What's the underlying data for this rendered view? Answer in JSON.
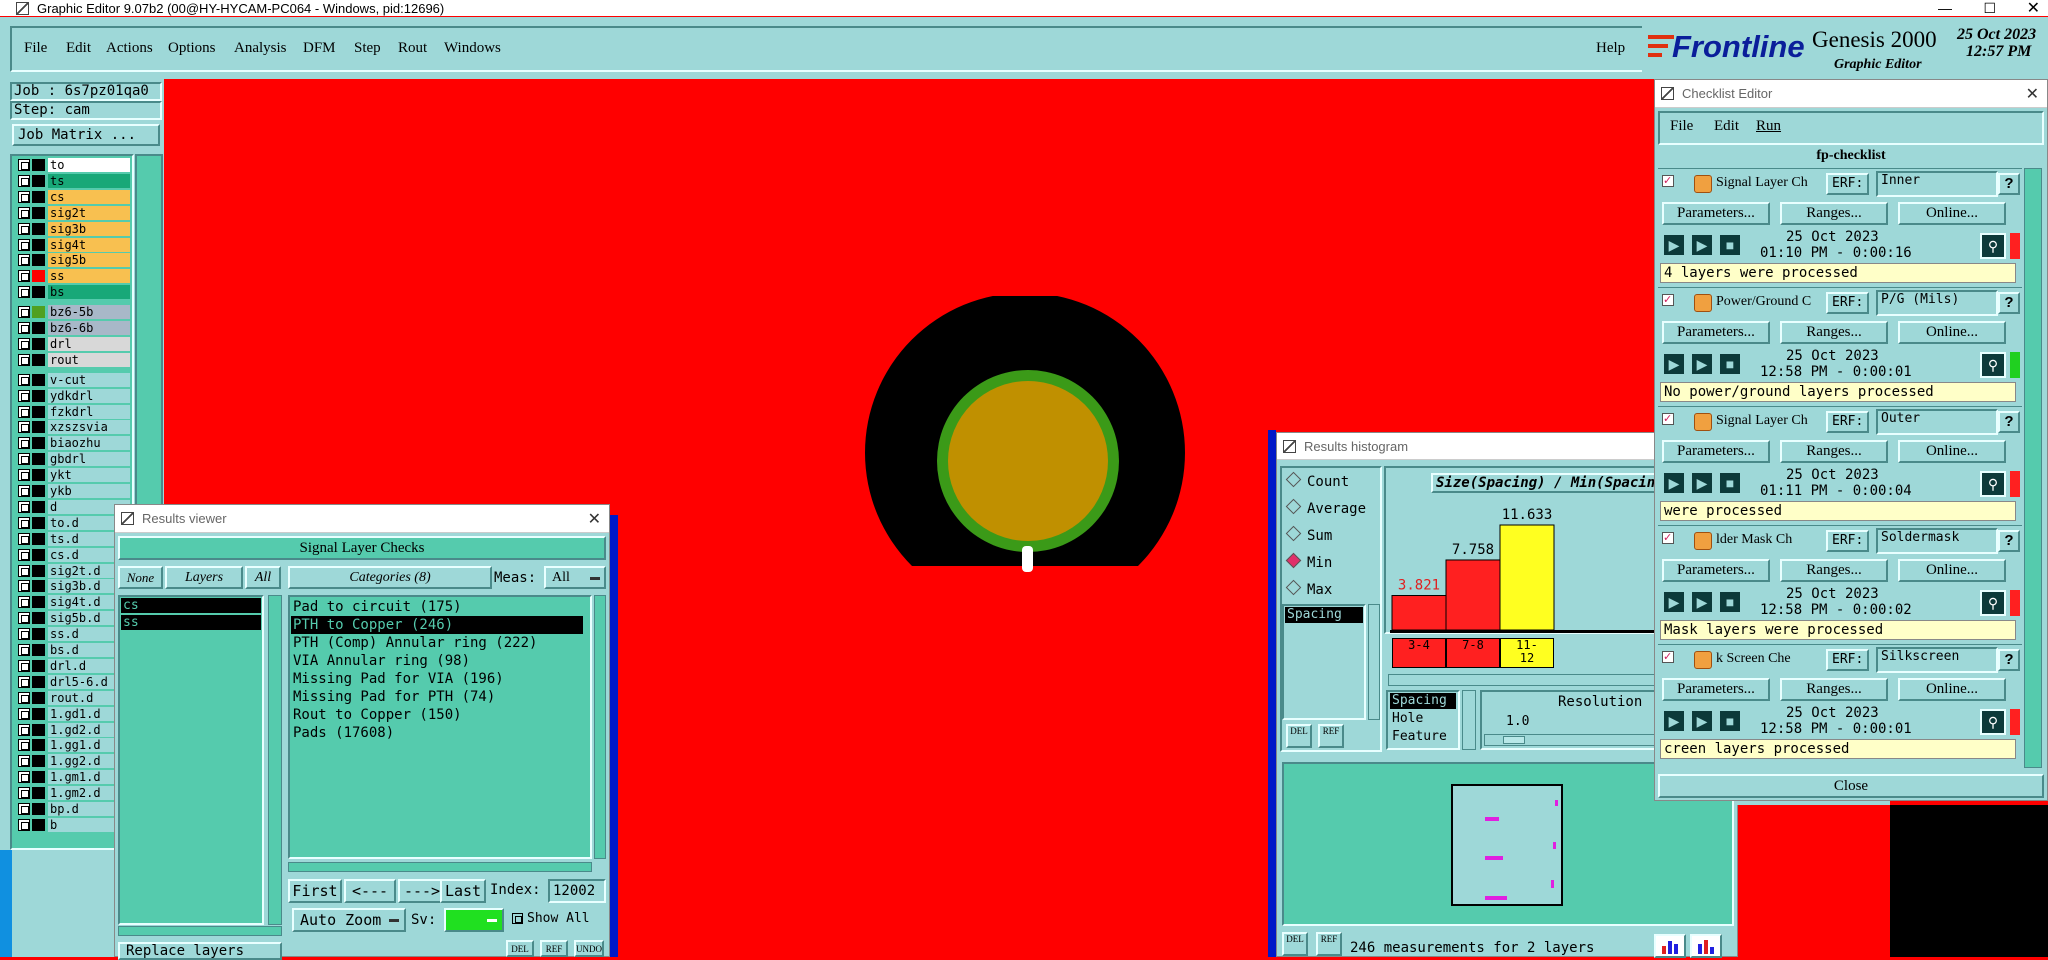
{
  "window_title": "Graphic Editor 9.07b2 (00@HY-HYCAM-PC064 - Windows, pid:12696)",
  "menu": [
    "File",
    "Edit",
    "Actions",
    "Options",
    "Analysis",
    "DFM",
    "Step",
    "Rout",
    "Windows"
  ],
  "help": "Help",
  "brand": {
    "name": "Frontline",
    "product": "Genesis 2000",
    "sub": "Graphic Editor",
    "date": "25 Oct 2023",
    "time": "12:57 PM"
  },
  "job": "Job : 6s7pz01qa0",
  "step": "Step: cam",
  "job_matrix": "Job Matrix ...",
  "layers": [
    {
      "name": "to",
      "color": "#ffffff",
      "sw": "#000000"
    },
    {
      "name": "ts",
      "color": "#18a878",
      "sw": "#000000"
    },
    {
      "name": "cs",
      "color": "#f8c050",
      "sw": "#000000"
    },
    {
      "name": "sig2t",
      "color": "#f8c050",
      "sw": "#000000"
    },
    {
      "name": "sig3b",
      "color": "#f8c050",
      "sw": "#000000"
    },
    {
      "name": "sig4t",
      "color": "#f8c050",
      "sw": "#000000"
    },
    {
      "name": "sig5b",
      "color": "#f8c050",
      "sw": "#000000"
    },
    {
      "name": "ss",
      "color": "#f8c050",
      "sw": "#ff0000"
    },
    {
      "name": "bs",
      "color": "#18a878",
      "sw": "#000000"
    },
    {
      "name": "bz6-5b",
      "color": "#a8b8c8",
      "sw": "#50a020"
    },
    {
      "name": "bz6-6b",
      "color": "#a8b8c8",
      "sw": "#000000"
    },
    {
      "name": "drl",
      "color": "#d8d8d8",
      "sw": "#000000"
    },
    {
      "name": "rout",
      "color": "#d8d8d8",
      "sw": "#000000"
    },
    {
      "name": "v-cut",
      "color": "#9ed8d8",
      "sw": "#000000"
    },
    {
      "name": "ydkdrl",
      "color": "#9ed8d8",
      "sw": "#000000"
    },
    {
      "name": "fzkdrl",
      "color": "#9ed8d8",
      "sw": "#000000"
    },
    {
      "name": "xzszsvia",
      "color": "#9ed8d8",
      "sw": "#000000"
    },
    {
      "name": "biaozhu",
      "color": "#9ed8d8",
      "sw": "#000000"
    },
    {
      "name": "gbdrl",
      "color": "#9ed8d8",
      "sw": "#000000"
    },
    {
      "name": "ykt",
      "color": "#9ed8d8",
      "sw": "#000000"
    },
    {
      "name": "ykb",
      "color": "#9ed8d8",
      "sw": "#000000"
    },
    {
      "name": "d",
      "color": "#9ed8d8",
      "sw": "#000000"
    },
    {
      "name": "to.d",
      "color": "#9ed8d8",
      "sw": "#000000"
    },
    {
      "name": "ts.d",
      "color": "#9ed8d8",
      "sw": "#000000"
    },
    {
      "name": "cs.d",
      "color": "#9ed8d8",
      "sw": "#000000"
    },
    {
      "name": "sig2t.d",
      "color": "#9ed8d8",
      "sw": "#000000"
    },
    {
      "name": "sig3b.d",
      "color": "#9ed8d8",
      "sw": "#000000"
    },
    {
      "name": "sig4t.d",
      "color": "#9ed8d8",
      "sw": "#000000"
    },
    {
      "name": "sig5b.d",
      "color": "#9ed8d8",
      "sw": "#000000"
    },
    {
      "name": "ss.d",
      "color": "#9ed8d8",
      "sw": "#000000"
    },
    {
      "name": "bs.d",
      "color": "#9ed8d8",
      "sw": "#000000"
    },
    {
      "name": "drl.d",
      "color": "#9ed8d8",
      "sw": "#000000"
    },
    {
      "name": "drl5-6.d",
      "color": "#9ed8d8",
      "sw": "#000000"
    },
    {
      "name": "rout.d",
      "color": "#9ed8d8",
      "sw": "#000000"
    },
    {
      "name": "1.gd1.d",
      "color": "#9ed8d8",
      "sw": "#000000"
    },
    {
      "name": "1.gd2.d",
      "color": "#9ed8d8",
      "sw": "#000000"
    },
    {
      "name": "1.gg1.d",
      "color": "#9ed8d8",
      "sw": "#000000"
    },
    {
      "name": "1.gg2.d",
      "color": "#9ed8d8",
      "sw": "#000000"
    },
    {
      "name": "1.gm1.d",
      "color": "#9ed8d8",
      "sw": "#000000"
    },
    {
      "name": "1.gm2.d",
      "color": "#9ed8d8",
      "sw": "#000000"
    },
    {
      "name": "bp.d",
      "color": "#9ed8d8",
      "sw": "#000000"
    },
    {
      "name": "b",
      "color": "#9ed8d8",
      "sw": "#000000"
    }
  ],
  "results_viewer": {
    "title": "Results viewer",
    "header": "Signal Layer Checks",
    "none": "None",
    "layers": "Layers",
    "all": "All",
    "categories_label": "Categories (8)",
    "meas_label": "Meas:",
    "meas_value": "All",
    "layer_list": [
      "cs",
      "ss"
    ],
    "categories": [
      "Pad to circuit (175)",
      "PTH to Copper (246)",
      "PTH (Comp) Annular ring (222)",
      "VIA Annular ring (98)",
      "Missing Pad for VIA (196)",
      "Missing Pad for PTH (74)",
      "Rout to Copper (150)",
      "Pads (17608)"
    ],
    "first": "First",
    "prev": "<---",
    "next": "--->",
    "last": "Last",
    "index_label": "Index:",
    "index_value": "12002",
    "auto_zoom": "Auto Zoom",
    "sv_label": "Sv:",
    "show_all": "Show All",
    "replace_layers": "Replace layers",
    "del": "DEL",
    "ref": "REF",
    "und": "UNDO"
  },
  "histogram": {
    "title": "Results histogram",
    "chart_title": "Size(Spacing) / Min(Spacing)",
    "modes": [
      "Count",
      "Average",
      "Sum",
      "Min",
      "Max"
    ],
    "selected_mode": "Min",
    "param": "Spacing",
    "params": [
      "Spacing",
      "Hole",
      "Feature"
    ],
    "resolution_label": "Resolution",
    "resolution_value": "1.0",
    "status": "246 measurements for 2 layers",
    "del": "DEL",
    "ref": "REF"
  },
  "chart_data": {
    "type": "bar",
    "title": "Size(Spacing) / Min(Spacing)",
    "categories": [
      "3-4",
      "7-8",
      "11-12"
    ],
    "values": [
      3.821,
      7.758,
      11.633
    ],
    "colors": [
      "#ff2020",
      "#ff2020",
      "#ffff20"
    ]
  },
  "checklist": {
    "title": "Checklist Editor",
    "menu": [
      "File",
      "Edit",
      "Run"
    ],
    "name": "fp-checklist",
    "close": "Close",
    "erf": "ERF:",
    "params": "Parameters...",
    "ranges": "Ranges...",
    "online": "Online...",
    "items": [
      {
        "name": "Signal Layer Ch",
        "erf": "Inner",
        "date": "25 Oct 2023",
        "time": "01:10 PM - 0:00:16",
        "status": "4 layers were processed",
        "ind": "#ff2020"
      },
      {
        "name": "Power/Ground C",
        "erf": "P/G (Mils)",
        "date": "25 Oct 2023",
        "time": "12:58 PM - 0:00:01",
        "status": "No power/ground layers processed",
        "ind": "#20d020"
      },
      {
        "name": "Signal Layer Ch",
        "erf": "Outer",
        "date": "25 Oct 2023",
        "time": "01:11 PM - 0:00:04",
        "status": "were processed",
        "ind": "#ff2020"
      },
      {
        "name": "lder Mask Ch",
        "erf": "Soldermask",
        "date": "25 Oct 2023",
        "time": "12:58 PM - 0:00:02",
        "status": "Mask layers were processed",
        "ind": "#ff2020"
      },
      {
        "name": "k Screen Che",
        "erf": "Silkscreen",
        "date": "25 Oct 2023",
        "time": "12:58 PM - 0:00:01",
        "status": "creen layers processed",
        "ind": "#ff2020"
      }
    ]
  }
}
